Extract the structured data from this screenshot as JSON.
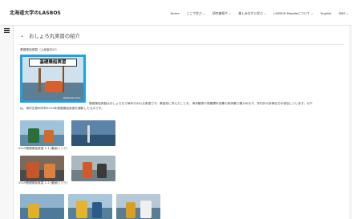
{
  "site": {
    "brand": "北海道大学のLASBOS"
  },
  "nav": {
    "items": [
      "Home",
      "ここで学ぶ ⌄",
      "研究者紹介 ⌄",
      "楽しみながら学ぶ ⌄",
      "LASBOS Moodleについて ⌄",
      "English",
      "DNS ⌄"
    ]
  },
  "section": {
    "title": "おしょろ丸実習の紹介"
  },
  "main": {
    "intro_caption": "基礎乗船実習（上級者向け）",
    "hero_title": "基礎乗船実習",
    "hero_footer": "Hokkaido Univ.",
    "paragraph_line1": "基礎乗船実習はおしょろ丸で毎年行われる実習です。乗船前に学んだことを、海洋観測や魚類標本採集の実体験で確かめます。学内外の多様な方が参加しています。以下",
    "paragraph_line2": "は、海洋生物科学科2019年基礎乗船実習を撮影したものです。",
    "caption1": "2019基礎乗船実習 1-1 (動画リンク)",
    "caption2": "2019基礎乗船実習 1-2 (動画リンク)"
  },
  "colors": {
    "accent": "#1fa3d9"
  }
}
